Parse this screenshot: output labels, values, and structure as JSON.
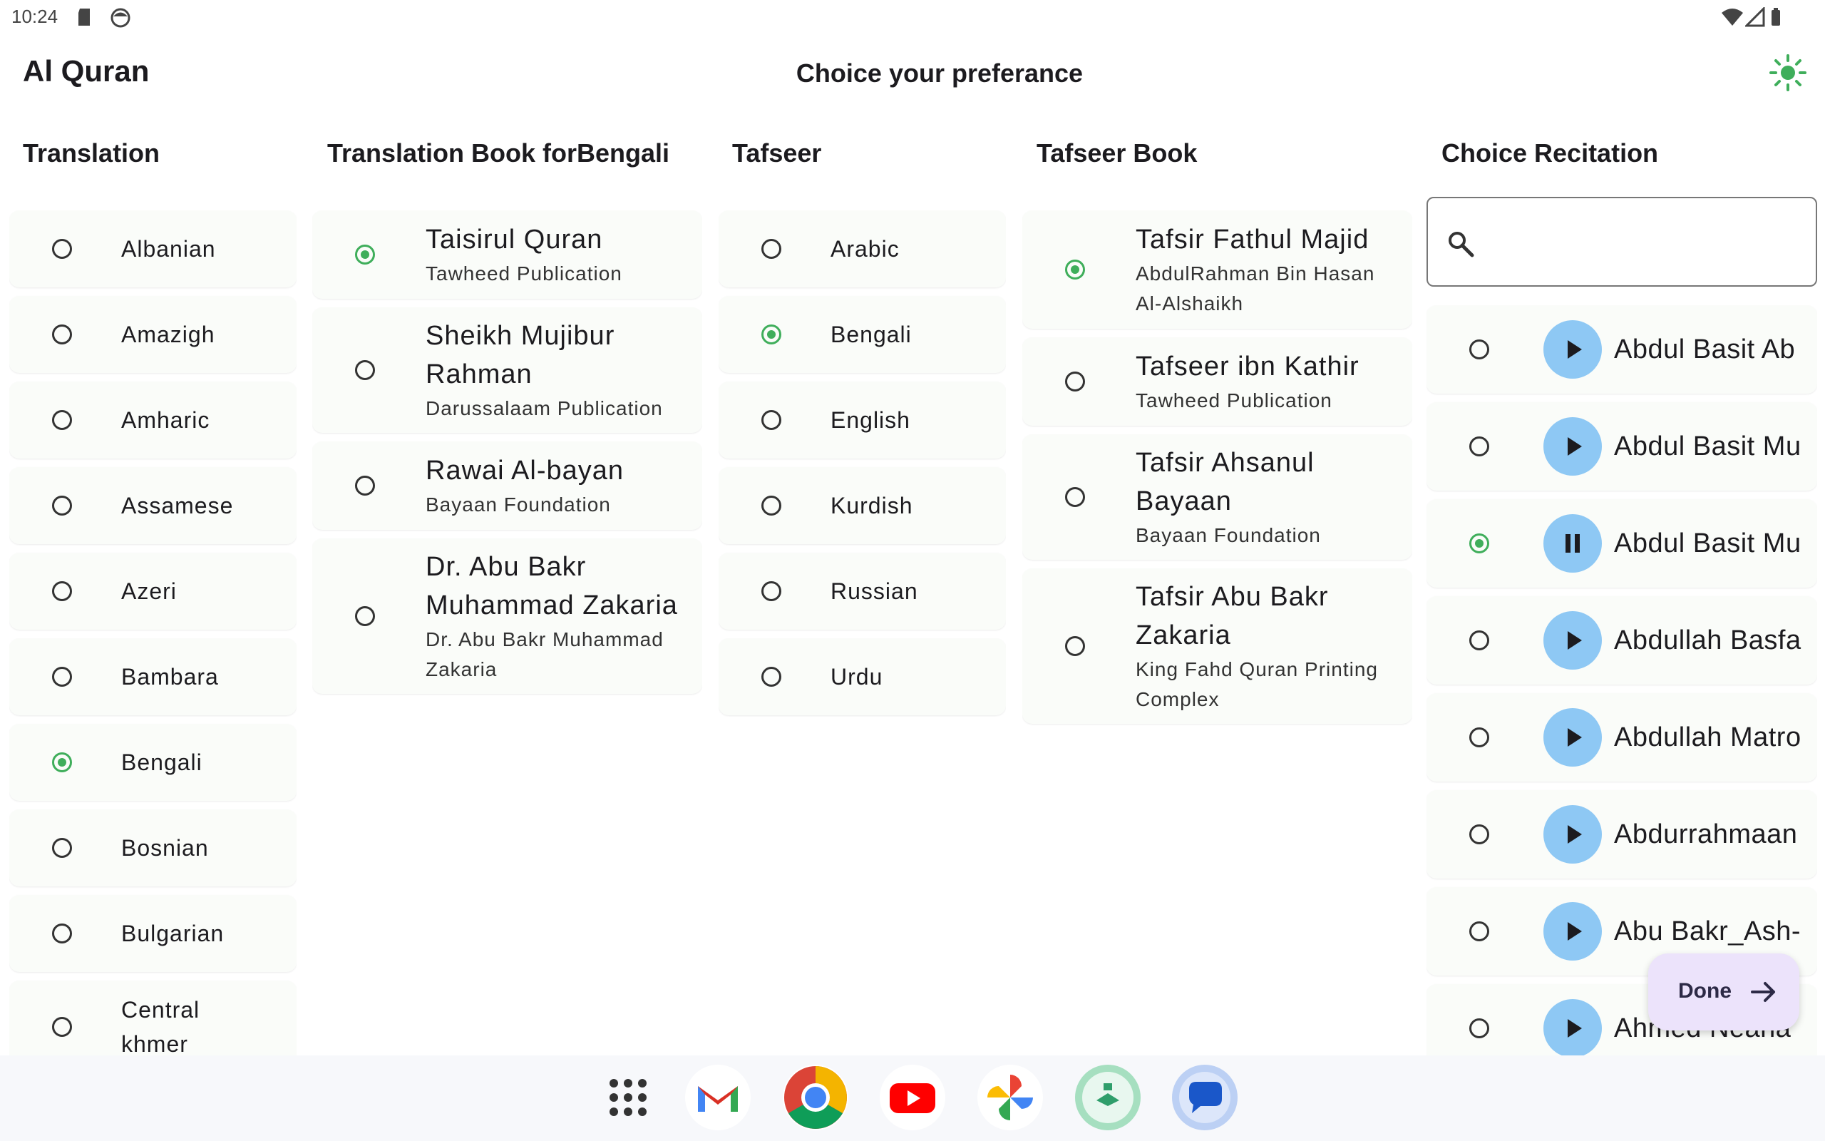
{
  "status": {
    "time": "10:24"
  },
  "app": {
    "title": "Al Quran",
    "page_title": "Choice your preferance"
  },
  "colors": {
    "accent_green": "#3fae5b",
    "play_blue": "#8ec8f4",
    "done_bg": "#ece3fb"
  },
  "translation": {
    "heading": "Translation",
    "selected": "Bengali",
    "items": [
      {
        "label": "Albanian",
        "selected": false
      },
      {
        "label": "Amazigh",
        "selected": false
      },
      {
        "label": "Amharic",
        "selected": false
      },
      {
        "label": "Assamese",
        "selected": false
      },
      {
        "label": "Azeri",
        "selected": false
      },
      {
        "label": "Bambara",
        "selected": false
      },
      {
        "label": "Bengali",
        "selected": true
      },
      {
        "label": "Bosnian",
        "selected": false
      },
      {
        "label": "Bulgarian",
        "selected": false
      },
      {
        "label": "Central khmer",
        "line1": "Central",
        "line2": "khmer",
        "selected": false
      }
    ]
  },
  "translation_book": {
    "heading": "Translation Book forBengali",
    "items": [
      {
        "title": "Taisirul Quran",
        "publisher": "Tawheed Publication",
        "selected": true
      },
      {
        "title_lines": [
          "Sheikh Mujibur",
          "Rahman"
        ],
        "publisher": "Darussalaam Publication",
        "selected": false
      },
      {
        "title": "Rawai Al-bayan",
        "publisher": "Bayaan Foundation",
        "selected": false
      },
      {
        "title_lines": [
          "Dr. Abu Bakr",
          "Muhammad Zakaria"
        ],
        "publisher_lines": [
          "Dr. Abu Bakr Muhammad",
          "Zakaria"
        ],
        "selected": false
      }
    ]
  },
  "tafseer": {
    "heading": "Tafseer",
    "items": [
      {
        "label": "Arabic",
        "selected": false
      },
      {
        "label": "Bengali",
        "selected": true
      },
      {
        "label": "English",
        "selected": false
      },
      {
        "label": "Kurdish",
        "selected": false
      },
      {
        "label": "Russian",
        "selected": false
      },
      {
        "label": "Urdu",
        "selected": false
      }
    ]
  },
  "tafseer_book": {
    "heading": "Tafseer Book",
    "items": [
      {
        "title": "Tafsir Fathul Majid",
        "publisher_lines": [
          "AbdulRahman Bin Hasan",
          "Al-Alshaikh"
        ],
        "selected": true
      },
      {
        "title": "Tafseer ibn Kathir",
        "publisher": "Tawheed Publication",
        "selected": false
      },
      {
        "title_lines": [
          "Tafsir Ahsanul",
          "Bayaan"
        ],
        "publisher": "Bayaan Foundation",
        "selected": false
      },
      {
        "title_lines": [
          "Tafsir Abu Bakr",
          "Zakaria"
        ],
        "publisher_lines": [
          "King Fahd Quran Printing",
          "Complex"
        ],
        "selected": false
      }
    ]
  },
  "recitation": {
    "heading": "Choice Recitation",
    "search": {
      "value": "",
      "icon": "search-icon"
    },
    "items": [
      {
        "name": "Abdul Basit Ab",
        "selected": false,
        "state": "play"
      },
      {
        "name": "Abdul Basit Mu",
        "selected": false,
        "state": "play"
      },
      {
        "name": "Abdul Basit Mu",
        "selected": true,
        "state": "pause"
      },
      {
        "name": "Abdullah Basfa",
        "selected": false,
        "state": "play"
      },
      {
        "name": "Abdullah Matro",
        "selected": false,
        "state": "play"
      },
      {
        "name": "Abdurrahmaan",
        "selected": false,
        "state": "play"
      },
      {
        "name": "Abu Bakr_Ash-",
        "selected": false,
        "state": "play"
      },
      {
        "name": "Ahmed Neana",
        "selected": false,
        "state": "play"
      }
    ]
  },
  "done_button": {
    "label": "Done"
  },
  "dock": {
    "apps": [
      "app-drawer-icon",
      "gmail-icon",
      "chrome-icon",
      "youtube-icon",
      "photos-icon",
      "al-quran-app-icon",
      "messages-icon"
    ]
  }
}
